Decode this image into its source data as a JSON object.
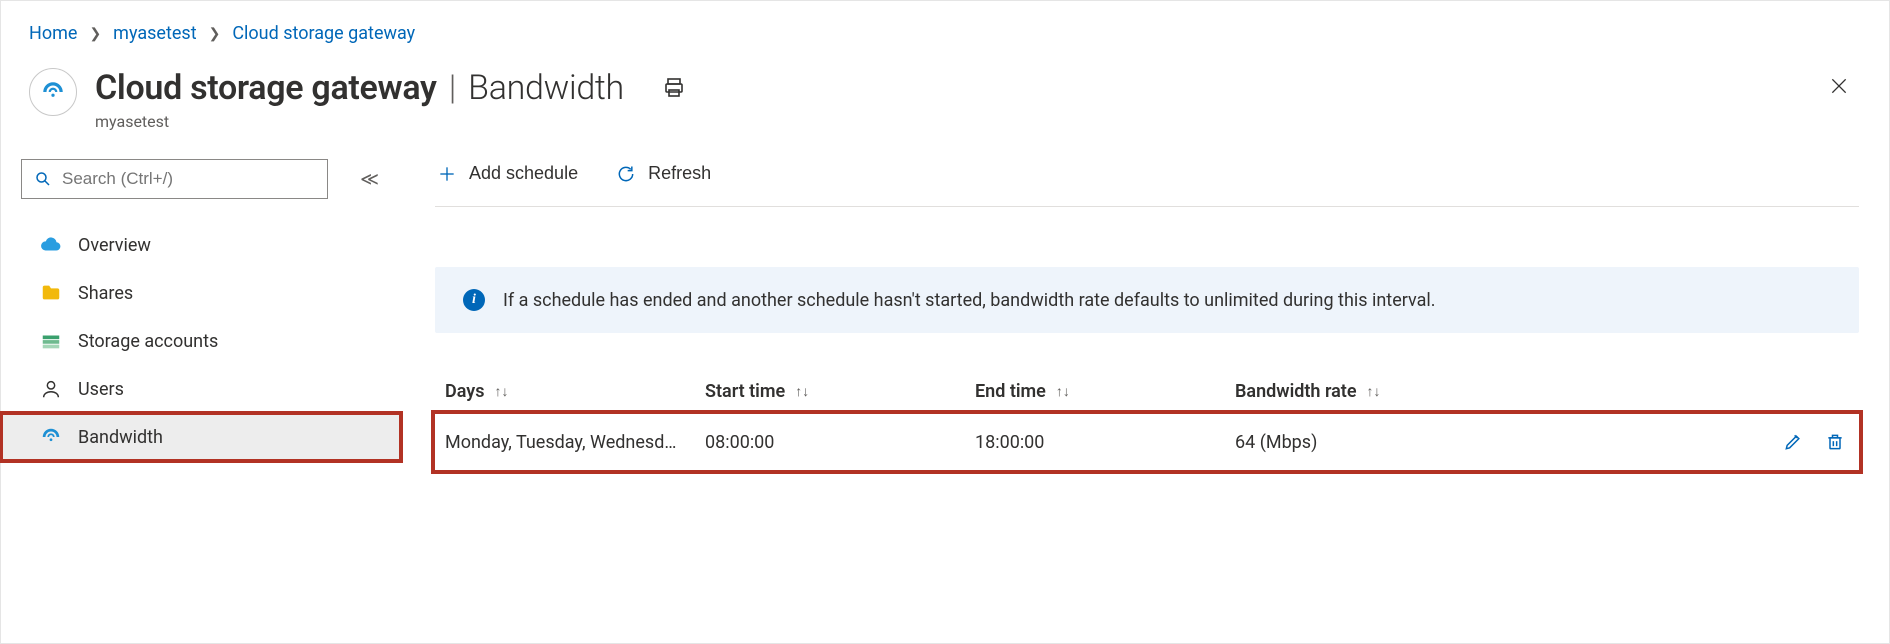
{
  "breadcrumb": {
    "home": "Home",
    "resource": "myasetest",
    "page": "Cloud storage gateway"
  },
  "header": {
    "title_strong": "Cloud storage gateway",
    "title_section": "Bandwidth",
    "subtitle": "myasetest"
  },
  "search": {
    "placeholder": "Search (Ctrl+/)"
  },
  "sidebar": {
    "items": [
      {
        "label": "Overview",
        "icon": "cloud"
      },
      {
        "label": "Shares",
        "icon": "folder"
      },
      {
        "label": "Storage accounts",
        "icon": "storage"
      },
      {
        "label": "Users",
        "icon": "person"
      },
      {
        "label": "Bandwidth",
        "icon": "gateway",
        "active": true
      }
    ]
  },
  "toolbar": {
    "add_label": "Add schedule",
    "refresh_label": "Refresh"
  },
  "info_banner": {
    "text": "If a schedule has ended and another schedule hasn't started, bandwidth rate defaults to unlimited during this interval."
  },
  "table": {
    "columns": {
      "days": "Days",
      "start": "Start time",
      "end": "End time",
      "rate": "Bandwidth rate"
    },
    "rows": [
      {
        "days": "Monday, Tuesday, Wednesd…",
        "start": "08:00:00",
        "end": "18:00:00",
        "rate": "64 (Mbps)"
      }
    ]
  }
}
